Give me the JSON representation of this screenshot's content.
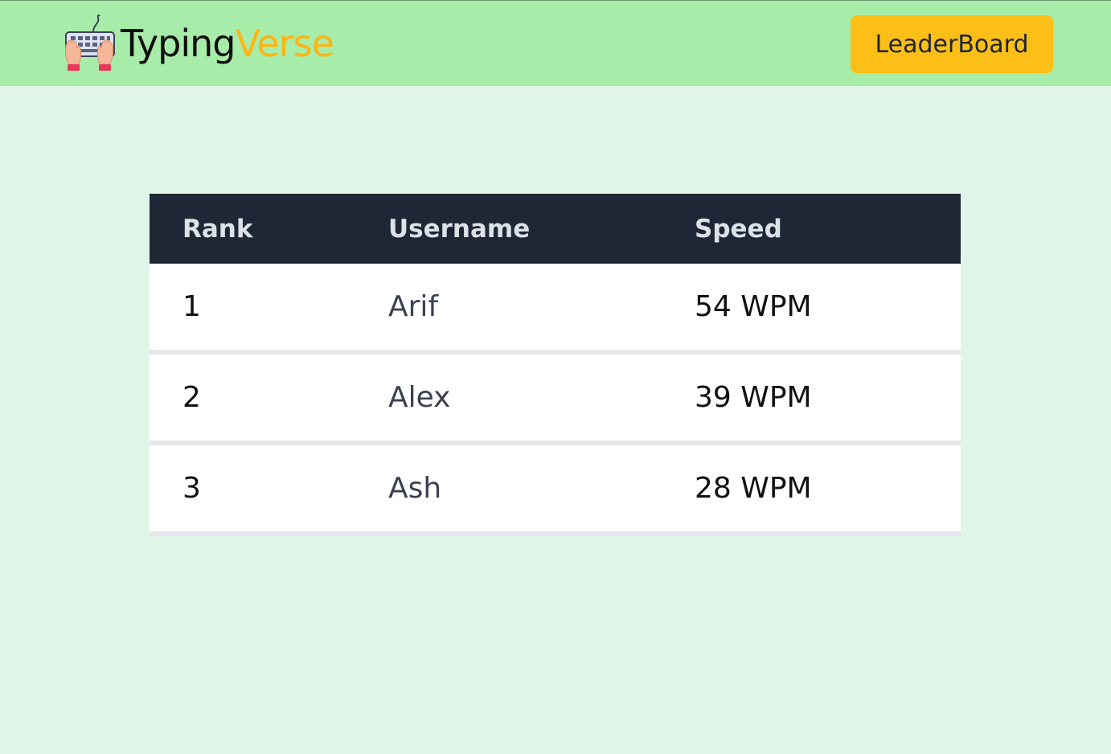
{
  "app": {
    "brand_part1": "Typing",
    "brand_part2": "Verse",
    "logo_icon": "keyboard-hands-icon"
  },
  "nav": {
    "leaderboard_label": "LeaderBoard"
  },
  "table": {
    "headers": [
      "Rank",
      "Username",
      "Speed"
    ],
    "rows": [
      {
        "rank": "1",
        "username": "Arif",
        "speed": "54 WPM"
      },
      {
        "rank": "2",
        "username": "Alex",
        "speed": "39 WPM"
      },
      {
        "rank": "3",
        "username": "Ash",
        "speed": "28 WPM"
      }
    ]
  },
  "colors": {
    "navbar_bg": "#a8eca9",
    "page_bg": "#dff5e8",
    "accent": "#fbbf17",
    "brand_highlight": "#fbb515",
    "table_header_bg": "#1f2737"
  }
}
